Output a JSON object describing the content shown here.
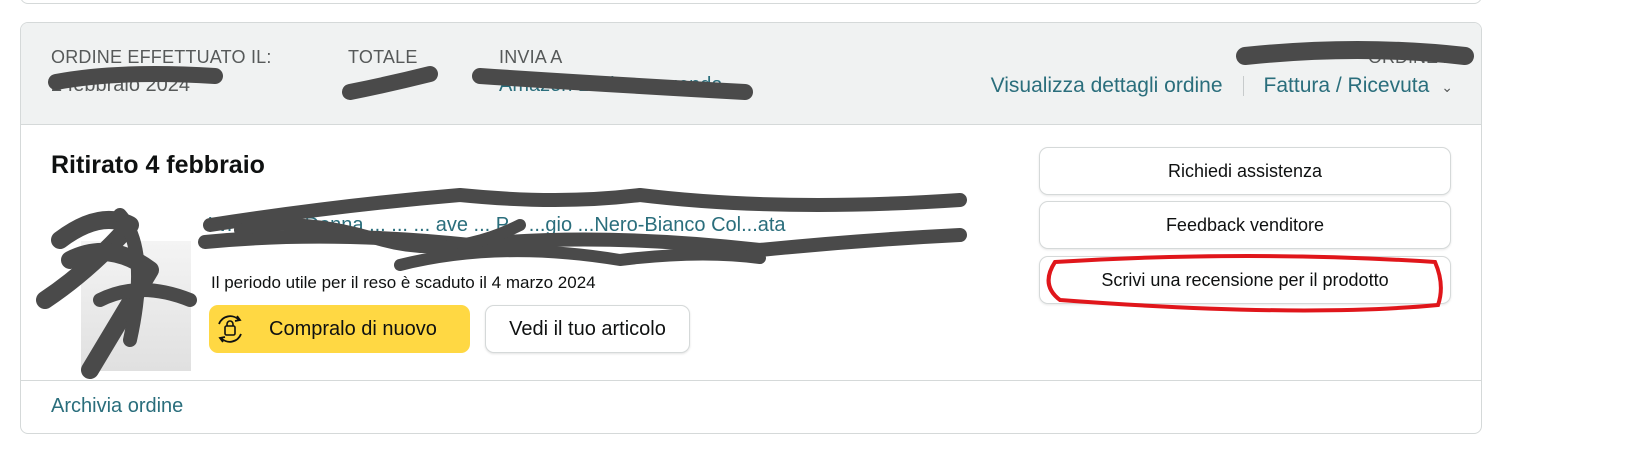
{
  "order": {
    "placed_label": "ORDINE EFFETTUATO IL:",
    "placed_value": "2 febbraio 2024",
    "total_label": "TOTALE",
    "total_value": "",
    "ship_label": "INVIA A",
    "ship_value": "Amazon Locker - guenda",
    "order_number_label": "ORDINE #",
    "order_number_value": "",
    "details_link": "Visualizza dettagli ordine",
    "invoice_link": "Fattura / Ricevuta"
  },
  "shipment": {
    "status": "Ritirato 4 febbraio",
    "product_title": "W... ...  ...a Donna ...   ...  ... ave  ... P...  ...gio ...Nero-Bianco Col...ata",
    "return_text": "Il periodo utile per il reso è scaduto il 4 marzo 2024",
    "buy_again_label": "Compralo di nuovo",
    "view_item_label": "Vedi il tuo articolo"
  },
  "actions": {
    "support_label": "Richiedi assistenza",
    "seller_feedback_label": "Feedback venditore",
    "write_review_label": "Scrivi una recensione per il prodotto"
  },
  "footer": {
    "archive_label": "Archivia ordine"
  },
  "colors": {
    "link": "#2a6e7c",
    "buy_button": "#ffd843",
    "header_bg": "#f0f2f2",
    "annotation_red": "#e0161b",
    "redaction": "#4a4a4a"
  },
  "icons": {
    "buy_again": "buy-again-icon",
    "chevron": "chevron-down-icon"
  }
}
